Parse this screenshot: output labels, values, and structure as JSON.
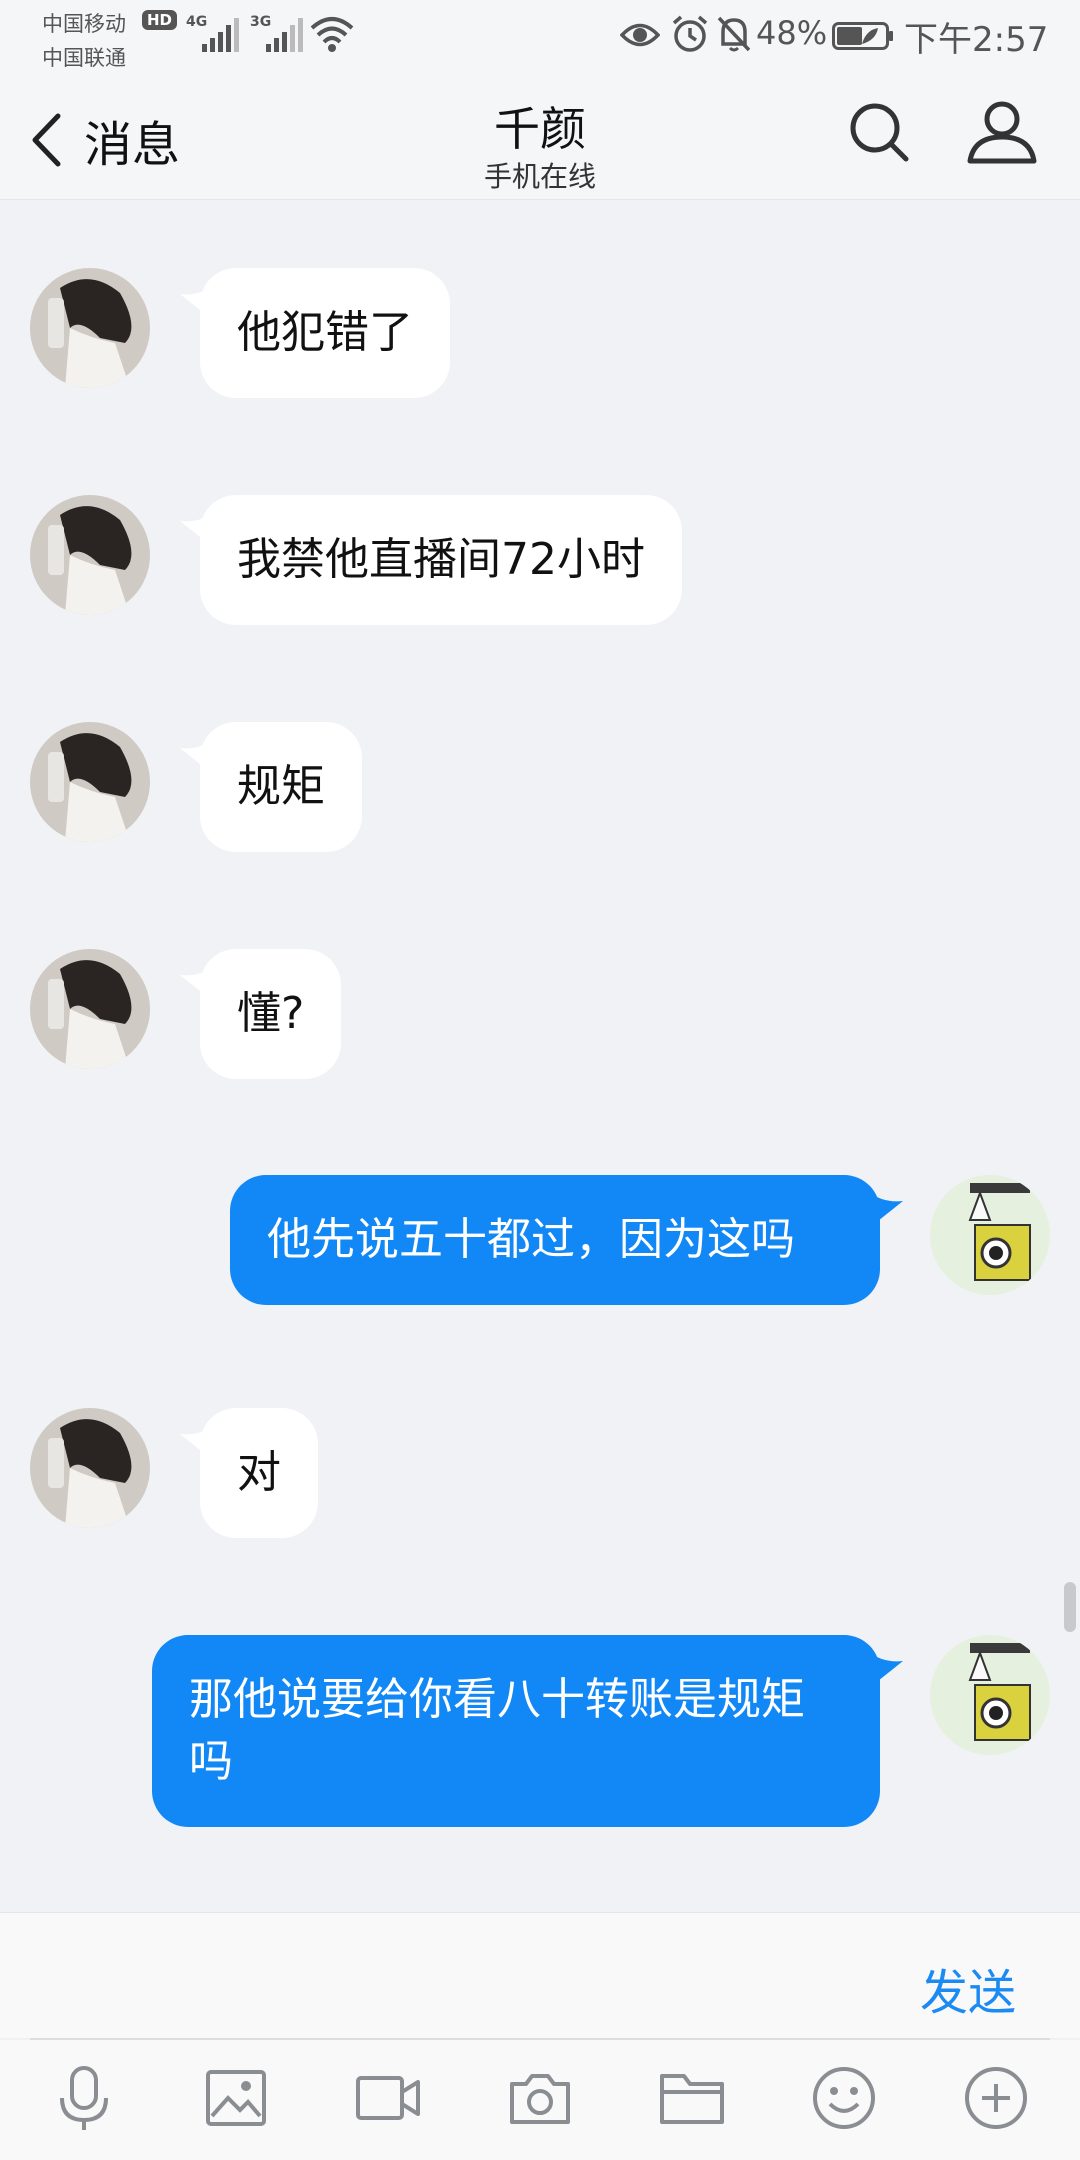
{
  "status_bar": {
    "carrier_1": "中国移动",
    "carrier_2": "中国联通",
    "hd_badge": "HD",
    "network_1": "4G",
    "network_2": "3G",
    "battery_percent": "48%",
    "time": "下午2:57",
    "icons": [
      "eye-icon",
      "alarm-icon",
      "bell-off-icon",
      "battery-icon",
      "wifi-icon"
    ]
  },
  "header": {
    "back_label": "消息",
    "title": "千颜",
    "subtitle": "手机在线",
    "icons": [
      "back-chevron-icon",
      "search-icon",
      "profile-icon"
    ]
  },
  "messages": [
    {
      "side": "in",
      "text": "他犯错了"
    },
    {
      "side": "in",
      "text": "我禁他直播间72小时"
    },
    {
      "side": "in",
      "text": "规矩"
    },
    {
      "side": "in",
      "text": "懂?"
    },
    {
      "side": "out",
      "text": "他先说五十都过，因为这吗"
    },
    {
      "side": "in",
      "text": "对"
    },
    {
      "side": "out",
      "text": "那他说要给你看八十转账是规矩吗"
    }
  ],
  "input": {
    "placeholder": "",
    "send_label": "发送"
  },
  "toolbar": {
    "icons": [
      "microphone-icon",
      "image-icon",
      "video-icon",
      "camera-icon",
      "folder-icon",
      "emoji-icon",
      "plus-icon"
    ]
  },
  "colors": {
    "background": "#f0f2f5",
    "incoming_bubble": "#ffffff",
    "outgoing_bubble": "#1287f6",
    "accent": "#1b8af2"
  }
}
